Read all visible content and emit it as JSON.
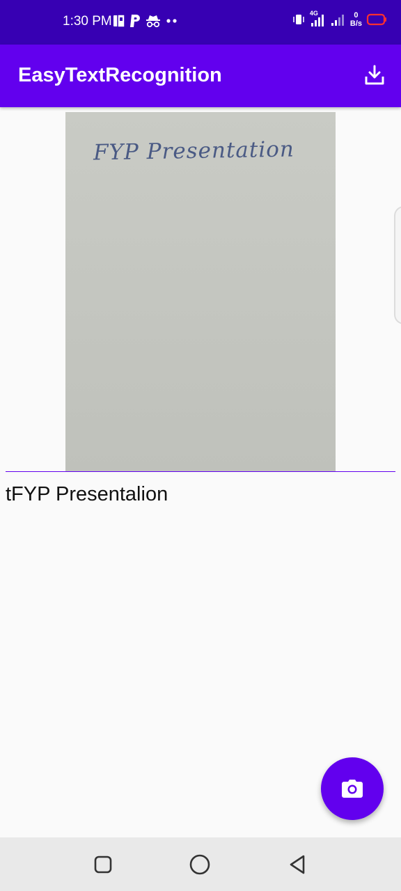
{
  "status_bar": {
    "time": "1:30 PM",
    "network_label": "4G",
    "net_speed_value": "0",
    "net_speed_unit": "B/s"
  },
  "app_bar": {
    "title": "EasyTextRecognition",
    "download_icon": "download-icon"
  },
  "image": {
    "handwritten_text": "FYP Presentation"
  },
  "result": {
    "text": "tFYP Presentalion"
  },
  "fab": {
    "icon": "camera-icon"
  },
  "nav": {
    "recents_icon": "square-icon",
    "home_icon": "circle-icon",
    "back_icon": "triangle-back-icon"
  },
  "colors": {
    "status_bar": "#3700b3",
    "primary": "#6200ee",
    "background": "#fafafa",
    "nav_bar": "#e9e9e9"
  }
}
